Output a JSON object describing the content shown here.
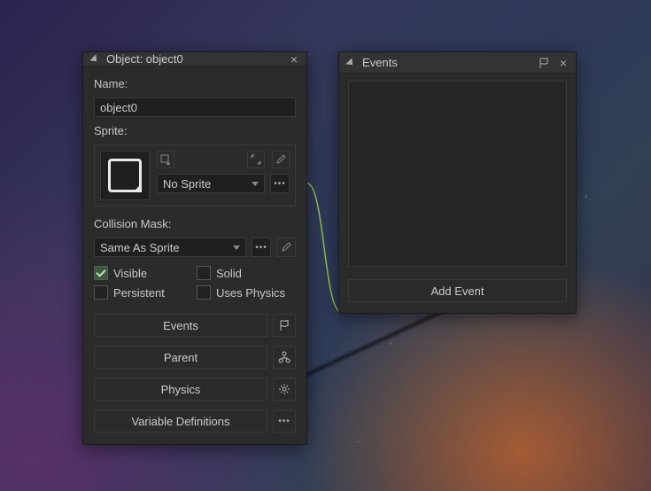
{
  "objectPanel": {
    "title": "Object: object0",
    "nameLabel": "Name:",
    "nameValue": "object0",
    "spriteLabel": "Sprite:",
    "spriteSelected": "No Sprite",
    "collisionMaskLabel": "Collision Mask:",
    "collisionMaskSelected": "Same As Sprite",
    "checks": {
      "visible": "Visible",
      "solid": "Solid",
      "persistent": "Persistent",
      "usesPhysics": "Uses Physics"
    },
    "buttons": {
      "events": "Events",
      "parent": "Parent",
      "physics": "Physics",
      "varDefs": "Variable Definitions"
    }
  },
  "eventsPanel": {
    "title": "Events",
    "addEvent": "Add Event"
  },
  "icons": {
    "flag": "flag-icon",
    "hierarchy": "hierarchy-icon",
    "gear": "gear-icon",
    "dots": "more-icon"
  },
  "states": {
    "visibleChecked": true,
    "solidChecked": false,
    "persistentChecked": false,
    "usesPhysicsChecked": false
  }
}
